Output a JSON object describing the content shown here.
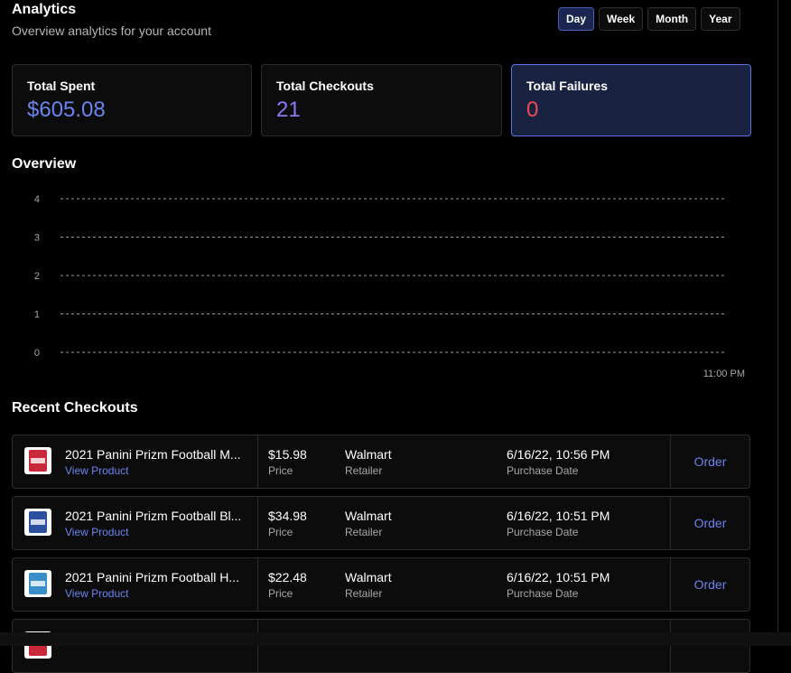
{
  "header": {
    "title": "Analytics",
    "subtitle": "Overview analytics for your account"
  },
  "range": {
    "options": [
      "Day",
      "Week",
      "Month",
      "Year"
    ],
    "active": "Day"
  },
  "stats": [
    {
      "label": "Total Spent",
      "value": "$605.08",
      "color": "#6b85f0"
    },
    {
      "label": "Total Checkouts",
      "value": "21",
      "color": "#8a7cf5"
    },
    {
      "label": "Total Failures",
      "value": "0",
      "color": "#ef4a55"
    }
  ],
  "overview": {
    "title": "Overview",
    "chart_data": {
      "type": "line",
      "x": [
        "11:00 PM"
      ],
      "series": [],
      "yticks": [
        "0",
        "1",
        "2",
        "3",
        "4"
      ],
      "ylim": [
        0,
        4
      ],
      "grid": true
    }
  },
  "recent": {
    "title": "Recent Checkouts",
    "price_label": "Price",
    "retailer_label": "Retailer",
    "date_label": "Purchase Date",
    "view_label": "View Product",
    "order_label": "Order",
    "rows": [
      {
        "name": "2021 Panini Prizm Football M...",
        "price": "$15.98",
        "retailer": "Walmart",
        "date": "6/16/22, 10:56 PM",
        "thumb_color": "#c8283a"
      },
      {
        "name": "2021 Panini Prizm Football Bl...",
        "price": "$34.98",
        "retailer": "Walmart",
        "date": "6/16/22, 10:51 PM",
        "thumb_color": "#2c4f9e"
      },
      {
        "name": "2021 Panini Prizm Football H...",
        "price": "$22.48",
        "retailer": "Walmart",
        "date": "6/16/22, 10:51 PM",
        "thumb_color": "#3a8ec9"
      }
    ]
  }
}
